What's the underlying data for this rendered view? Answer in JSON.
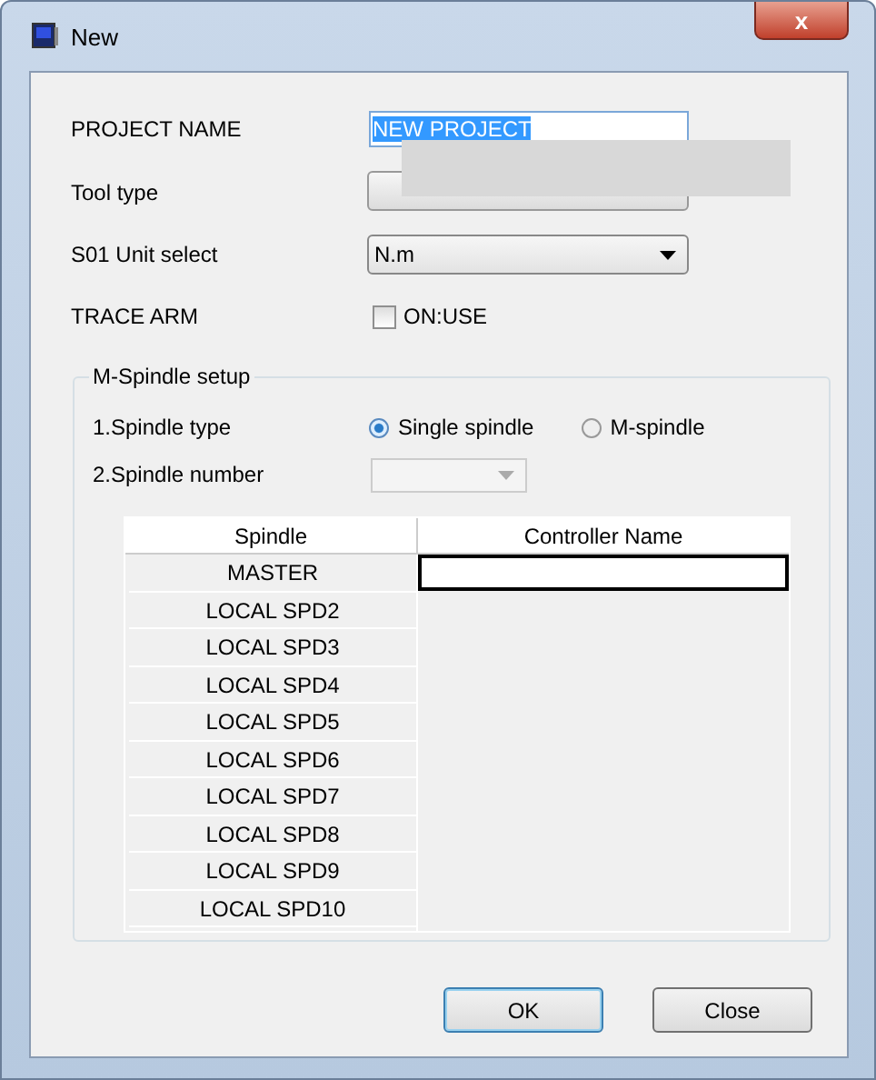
{
  "window": {
    "title": "New",
    "close": "x"
  },
  "fields": [
    {
      "kind": "text",
      "label": "PROJECT NAME",
      "value": "NEW PROJECT"
    },
    {
      "kind": "button",
      "label": "Tool type"
    },
    {
      "kind": "dropdown",
      "label": "S01 Unit select",
      "value": "N.m"
    },
    {
      "kind": "checkbox",
      "label": "TRACE ARM",
      "option": "ON:USE",
      "checked": false
    }
  ],
  "spindle_setup": {
    "title": "M-Spindle setup",
    "type_label": "1.Spindle type",
    "types": [
      {
        "label": "Single spindle",
        "selected": true
      },
      {
        "label": "M-spindle",
        "selected": false
      }
    ],
    "number_label": "2.Spindle number",
    "number_disabled": true,
    "table": {
      "columns": [
        "Spindle",
        "Controller Name"
      ],
      "rows": [
        "MASTER",
        "LOCAL SPD2",
        "LOCAL SPD3",
        "LOCAL SPD4",
        "LOCAL SPD5",
        "LOCAL SPD6",
        "LOCAL SPD7",
        "LOCAL SPD8",
        "LOCAL SPD9",
        "LOCAL SPD10"
      ]
    }
  },
  "buttons": [
    "OK",
    "Close"
  ]
}
